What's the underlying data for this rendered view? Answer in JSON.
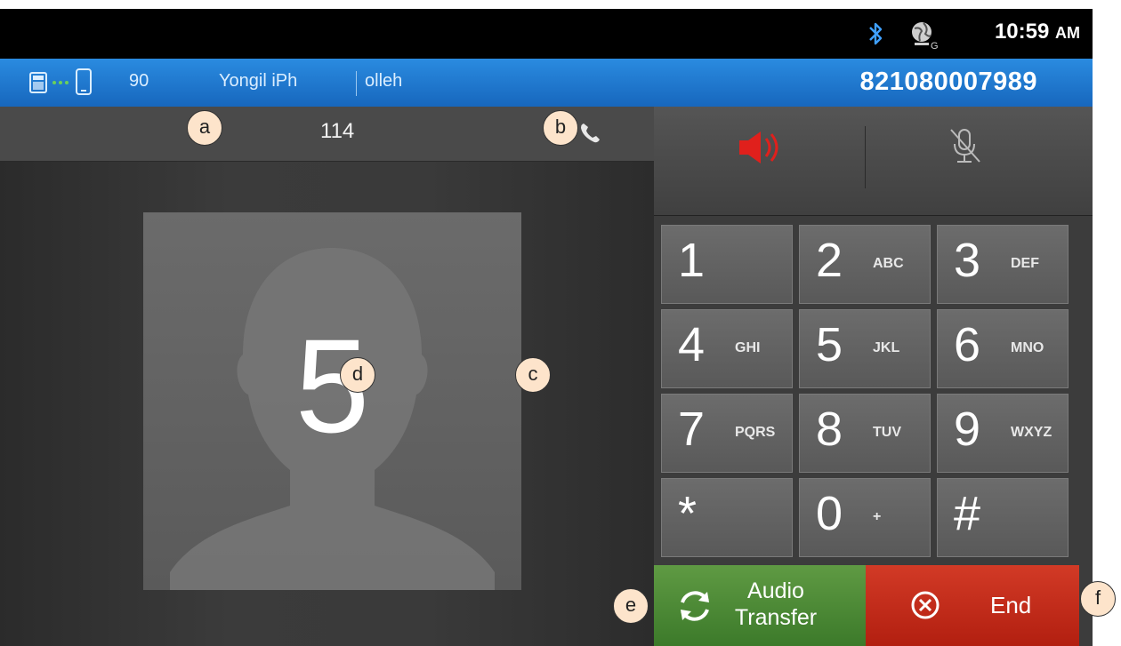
{
  "status_bar": {
    "time": "10:59",
    "ampm": "AM",
    "icons": [
      "bluetooth-icon",
      "globe-signal-icon"
    ]
  },
  "info_bar": {
    "signal_value": "90",
    "device_name": "Yongil iPh",
    "carrier": "olleh",
    "phone_number": "821080007989",
    "icons": [
      "phone-device-icon",
      "mobile-phone-icon"
    ]
  },
  "call": {
    "number": "114",
    "avatar_digit": "5"
  },
  "audio": {
    "speaker_icon": "speaker-icon",
    "mute_icon": "mic-mute-icon"
  },
  "keypad": [
    {
      "digit": "1",
      "letters": ""
    },
    {
      "digit": "2",
      "letters": "ABC"
    },
    {
      "digit": "3",
      "letters": "DEF"
    },
    {
      "digit": "4",
      "letters": "GHI"
    },
    {
      "digit": "5",
      "letters": "JKL"
    },
    {
      "digit": "6",
      "letters": "MNO"
    },
    {
      "digit": "7",
      "letters": "PQRS"
    },
    {
      "digit": "8",
      "letters": "TUV"
    },
    {
      "digit": "9",
      "letters": "WXYZ"
    },
    {
      "digit": "*",
      "letters": ""
    },
    {
      "digit": "0",
      "letters": "+"
    },
    {
      "digit": "#",
      "letters": ""
    }
  ],
  "actions": {
    "transfer_line1": "Audio",
    "transfer_line2": "Transfer",
    "end_label": "End"
  },
  "annotations": [
    "a",
    "b",
    "c",
    "d",
    "e",
    "f"
  ],
  "colors": {
    "info_bar": "#1f7ad0",
    "transfer": "#4c8a36",
    "end": "#c22b1a",
    "speaker": "#e0201c"
  }
}
